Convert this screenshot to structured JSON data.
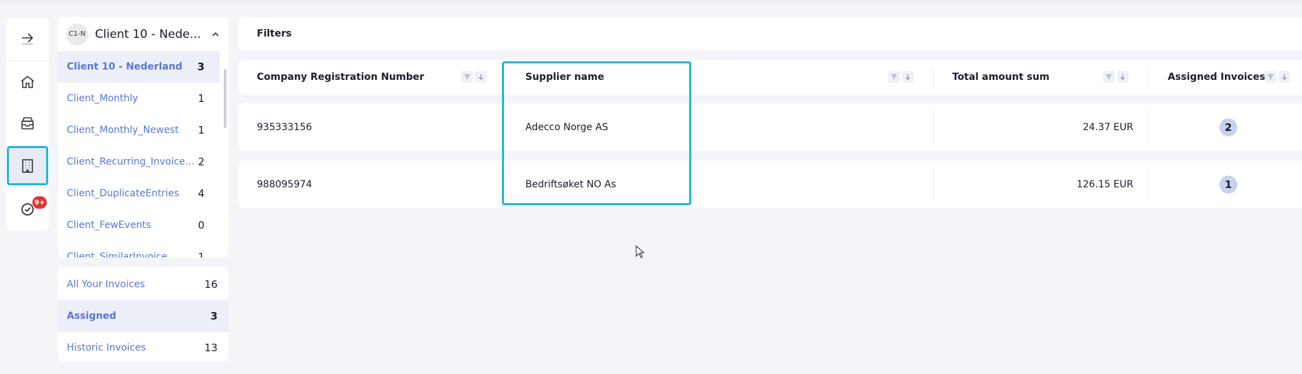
{
  "client_panel": {
    "avatar_text": "C1-N",
    "title": "Client 10 - Nede...",
    "items": [
      {
        "name": "Client 10 - Nederland",
        "count": "3"
      },
      {
        "name": "Client_Monthly",
        "count": "1"
      },
      {
        "name": "Client_Monthly_Newest",
        "count": "1"
      },
      {
        "name": "Client_Recurring_Invoice_P...",
        "count": "2"
      },
      {
        "name": "Client_DuplicateEntries",
        "count": "4"
      },
      {
        "name": "Client_FewEvents",
        "count": "0"
      },
      {
        "name": "Client_SimilarInvoice",
        "count": "1"
      }
    ]
  },
  "invoice_panel": {
    "items": [
      {
        "name": "All Your Invoices",
        "count": "16"
      },
      {
        "name": "Assigned",
        "count": "3"
      },
      {
        "name": "Historic Invoices",
        "count": "13"
      }
    ]
  },
  "rail": {
    "badge": "9+",
    "icons": [
      "arrow-right-icon",
      "home-icon",
      "inbox-icon",
      "building-icon",
      "check-circle-icon"
    ]
  },
  "filters_label": "Filters",
  "table": {
    "columns": [
      "Company Registration Number",
      "Supplier name",
      "Total amount sum",
      "Assigned Invoices"
    ],
    "rows": [
      {
        "reg": "935333156",
        "supplier": "Adecco Norge AS",
        "amount": "24.37 EUR",
        "assigned": "2"
      },
      {
        "reg": "988095974",
        "supplier": "Bedriftsøket NO As",
        "amount": "126.15 EUR",
        "assigned": "1"
      }
    ]
  },
  "colors": {
    "accent": "#1fb6e0",
    "link": "#5a75d6",
    "badge": "#e5322d",
    "pill": "#c8d2f0"
  }
}
